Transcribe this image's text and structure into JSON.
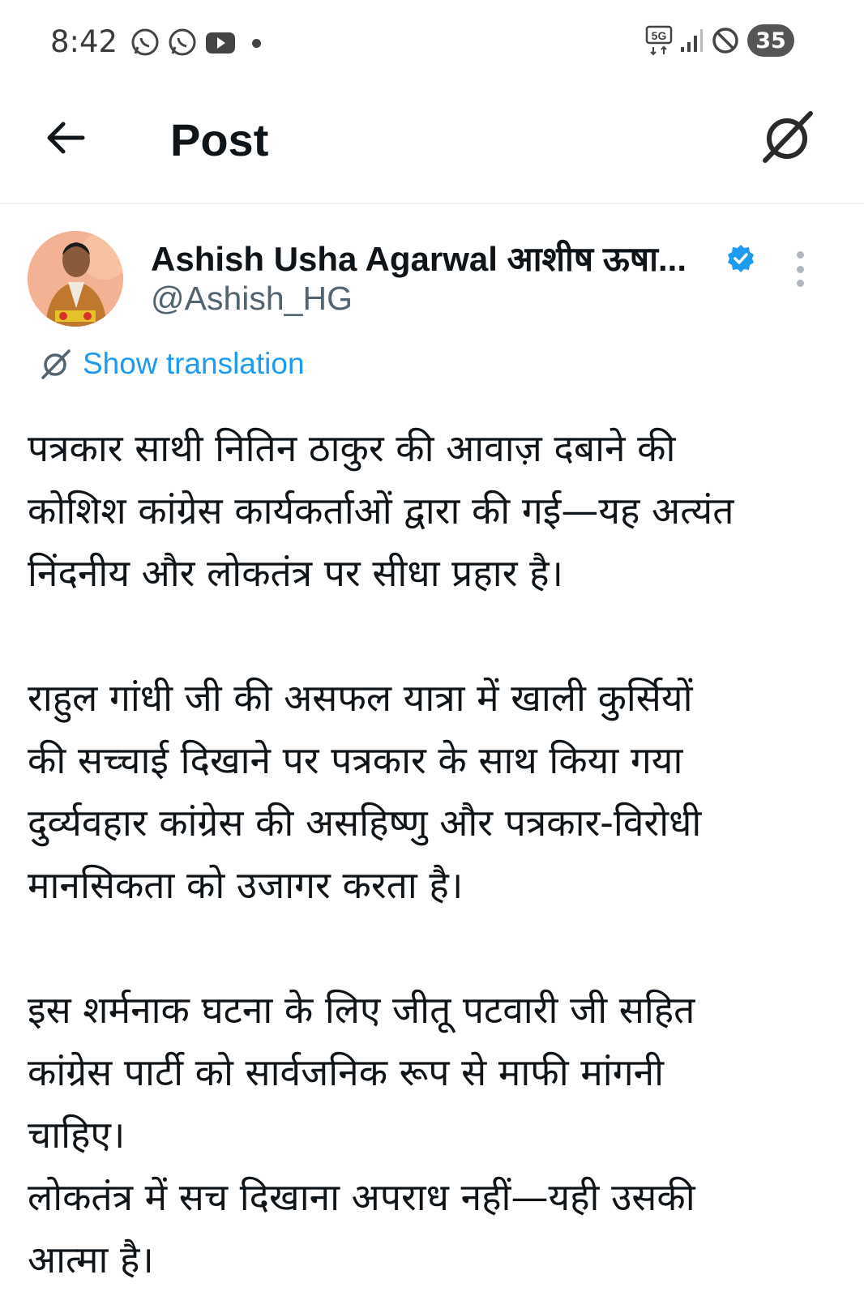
{
  "status_bar": {
    "time": "8:42",
    "network": "5G",
    "battery": "35",
    "icons_left": [
      "whatsapp-icon",
      "whatsapp-icon",
      "youtube-icon"
    ],
    "icons_right": [
      "5g-icon",
      "signal-icon",
      "dnd-icon",
      "battery-icon"
    ]
  },
  "header": {
    "title": "Post",
    "back_icon": "arrow-left-icon",
    "action_icon": "grok-icon"
  },
  "post": {
    "author_name": "Ashish Usha Agarwal आशीष ऊषा...",
    "handle": "@Ashish_HG",
    "verified": true,
    "translate_label": "Show translation",
    "paragraphs": [
      [
        "पत्रकार साथी नितिन ठाकुर की आवाज़ दबाने की",
        "कोशिश कांग्रेस कार्यकर्ताओं द्वारा की गई—यह अत्यंत",
        "निंदनीय और लोकतंत्र पर सीधा प्रहार है।"
      ],
      [
        "राहुल गांधी जी की असफल यात्रा में खाली कुर्सियों",
        "की सच्चाई दिखाने पर पत्रकार के साथ किया गया",
        "दुर्व्यवहार कांग्रेस की असहिष्णु और पत्रकार-विरोधी",
        "मानसिकता को उजागर करता है।"
      ],
      [
        "इस शर्मनाक घटना के लिए जीतू पटवारी जी सहित",
        "कांग्रेस पार्टी को सार्वजनिक रूप से माफी मांगनी",
        "चाहिए।",
        "लोकतंत्र में सच दिखाना अपराध नहीं—यही उसकी",
        "आत्मा है।"
      ]
    ]
  },
  "colors": {
    "accent": "#1d9bf0",
    "text": "#0f1419",
    "secondary": "#536471",
    "avatar_bg": "#f4b295"
  }
}
